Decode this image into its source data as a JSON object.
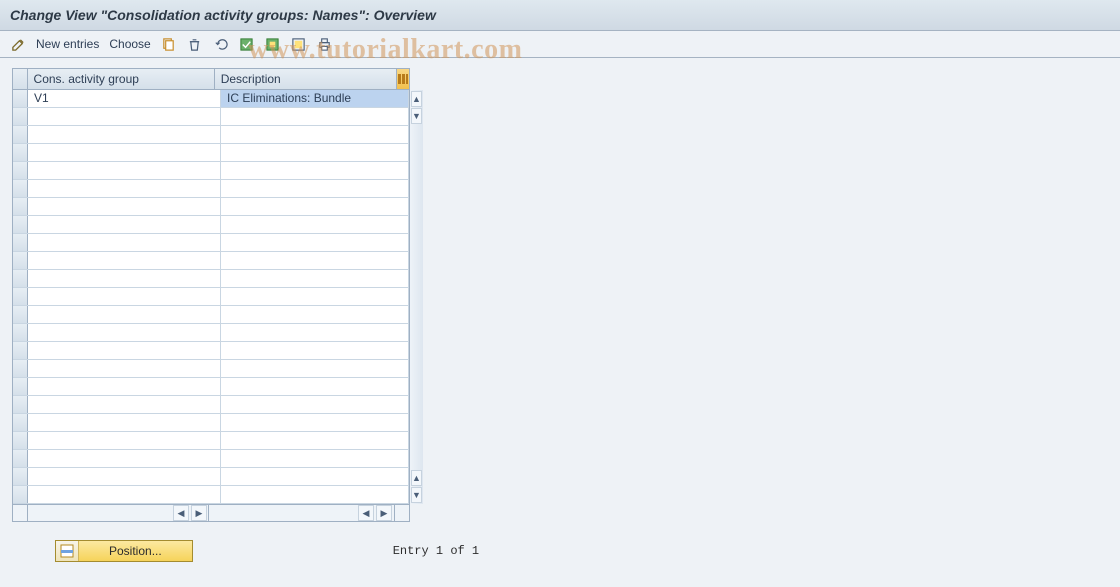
{
  "title": "Change View \"Consolidation activity groups: Names\": Overview",
  "toolbar": {
    "new_entries": "New entries",
    "choose": "Choose"
  },
  "watermark": "www.tutorialkart.com",
  "table": {
    "columns": {
      "c1": "Cons. activity group",
      "c2": "Description"
    },
    "rows": [
      {
        "c1": "V1",
        "c2": "IC Eliminations:  Bundle"
      }
    ],
    "blank_rows": 22
  },
  "footer": {
    "position": "Position...",
    "entry": "Entry 1 of 1"
  }
}
